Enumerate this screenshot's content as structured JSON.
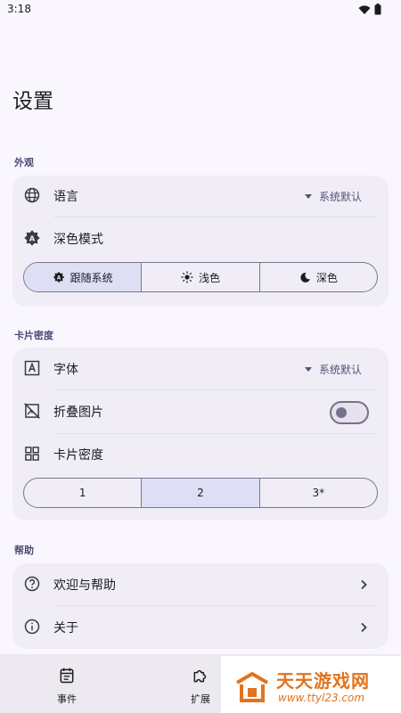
{
  "status_bar": {
    "time": "3:18"
  },
  "page": {
    "title": "设置"
  },
  "appearance": {
    "section_title": "外观",
    "language": {
      "label": "语言",
      "value": "系统默认"
    },
    "dark_mode": {
      "label": "深色模式",
      "options": [
        {
          "label": "跟随系统",
          "icon": "auto-brightness-icon"
        },
        {
          "label": "浅色",
          "icon": "sun-icon"
        },
        {
          "label": "深色",
          "icon": "moon-icon"
        }
      ],
      "selected_index": 0
    }
  },
  "card_density": {
    "section_title": "卡片密度",
    "font": {
      "label": "字体",
      "value": "系统默认"
    },
    "fold_images": {
      "label": "折叠图片",
      "enabled": false
    },
    "density": {
      "label": "卡片密度",
      "options": [
        "1",
        "2",
        "3*"
      ],
      "selected_index": 1
    }
  },
  "help": {
    "section_title": "帮助",
    "welcome": {
      "label": "欢迎与帮助"
    },
    "about": {
      "label": "关于"
    }
  },
  "bottom_nav": {
    "items": [
      {
        "label": "事件",
        "icon": "calendar-list-icon"
      },
      {
        "label": "扩展",
        "icon": "puzzle-icon"
      }
    ]
  },
  "watermark": {
    "title": "天天游戏网",
    "url": "www.ttyl23.com"
  },
  "colors": {
    "background": "#f9f6fd",
    "card": "#f0edf6",
    "selected_segment": "#dedff5",
    "section_title": "#4e4a75",
    "watermark_orange": "#e2731d"
  }
}
